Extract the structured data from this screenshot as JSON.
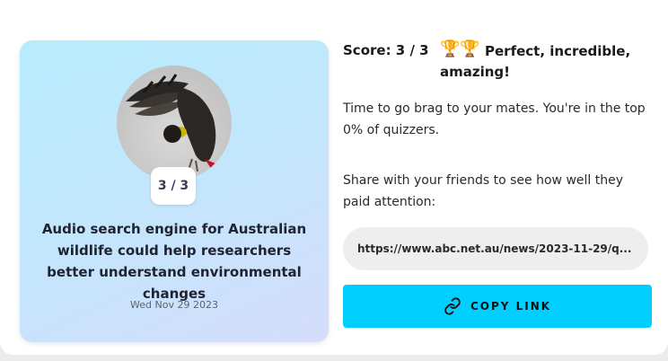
{
  "result": {
    "score_label": "Score: 3 / 3",
    "trophies": "🏆🏆",
    "headline": "Perfect, incredible, amazing!",
    "brag_message": "Time to go brag to your mates. You're in the top 0% of quizzers.",
    "share_prompt": "Share with your friends to see how well they paid attention:"
  },
  "share": {
    "link": "https://www.abc.net.au/news/2023-11-29/q...",
    "copy_label": "COPY LINK"
  },
  "card": {
    "score": "3 / 3",
    "title": "Audio search engine for Australian wildlife could help researchers better understand environmental changes",
    "date": "Wed Nov 29 2023"
  },
  "colors": {
    "accent": "#00cfff",
    "card_gradient_start": "#b7ecfd",
    "card_gradient_end": "#d4dcfb",
    "link_field_bg": "#eeeeee"
  },
  "icons": {
    "copy": "link-icon",
    "trophy": "trophy-icon"
  }
}
